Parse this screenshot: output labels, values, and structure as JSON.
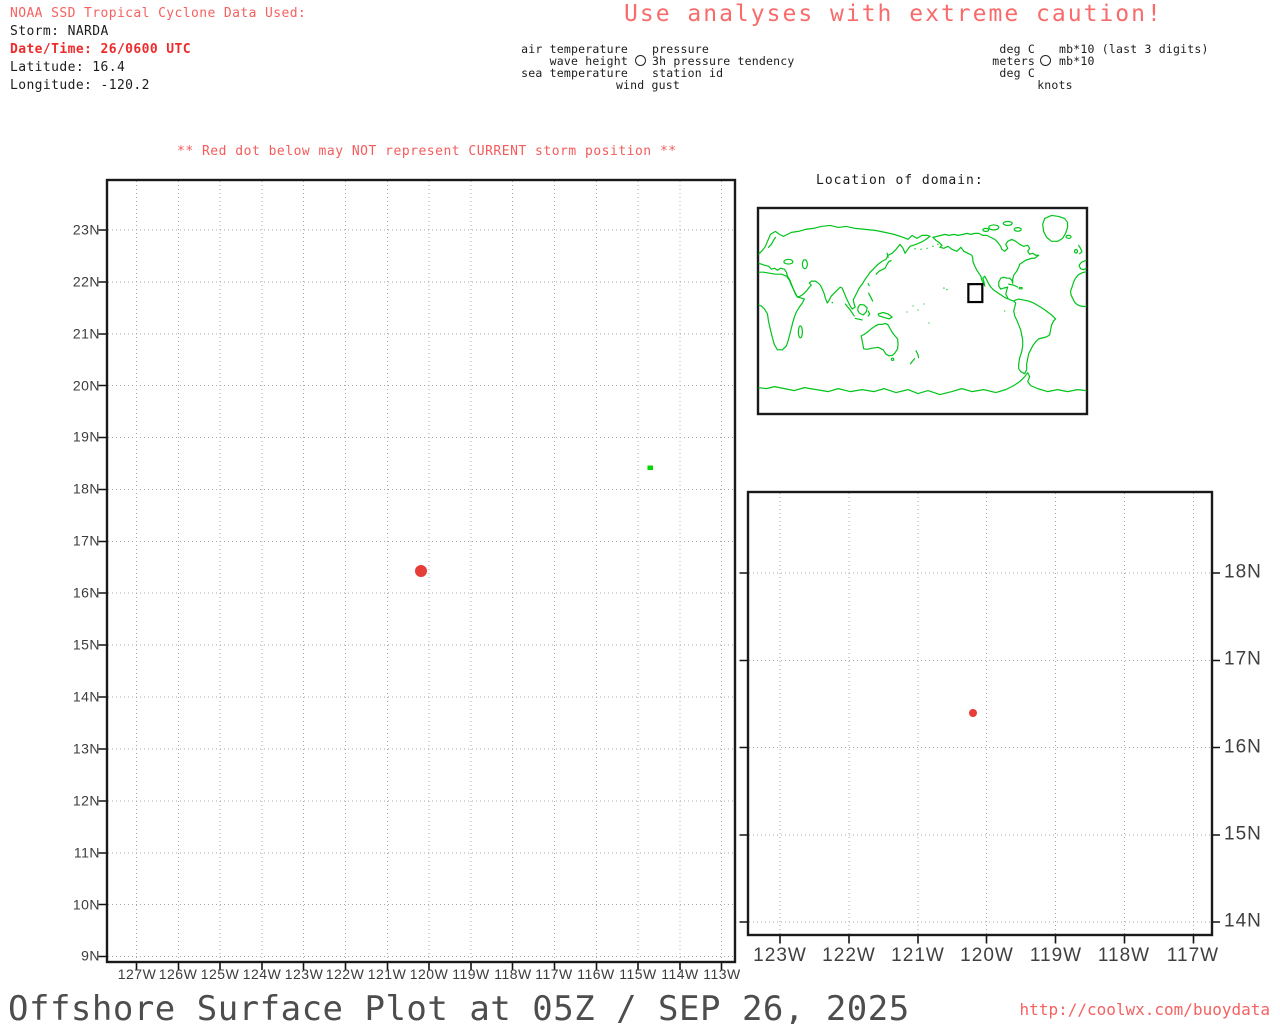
{
  "header": {
    "source_line": "NOAA SSD Tropical Cyclone Data Used:",
    "storm_line": "Storm: NARDA",
    "datetime_line": "Date/Time: 26/0600 UTC",
    "latitude_line": "Latitude: 16.4",
    "longitude_line": "Longitude: -120.2"
  },
  "caution_banner": "Use analyses with extreme caution!",
  "station_model_legend": {
    "air_temperature": "air temperature",
    "wave_height": "wave height",
    "sea_temperature": "sea temperature",
    "wind_gust": "wind gust",
    "pressure": "pressure",
    "pressure_tendency": "3h pressure tendency",
    "station_id": "station id"
  },
  "units_legend": {
    "air_temp_units": "deg C",
    "pressure_units": "mb*10 (last 3 digits)",
    "wave_units": "meters",
    "tendency_units": "mb*10",
    "sea_units": "deg C",
    "gust_units": "knots"
  },
  "warning": "** Red dot below may NOT represent CURRENT storm position **",
  "domain_map": {
    "title": "Location of domain:"
  },
  "footer": {
    "title": "Offshore Surface Plot at 05Z / SEP 26, 2025",
    "url": "http://coolwx.com/buoydata"
  },
  "colors": {
    "caution_red": "#f76060",
    "bold_red": "#ee2b2b",
    "storm_dot": "#e63d38",
    "map_green": "#00c41a",
    "grid_gray": "#ababab"
  },
  "chart_data": [
    {
      "type": "scatter",
      "name": "main_offshore_plot",
      "x_ticks": [
        "127W",
        "126W",
        "125W",
        "124W",
        "123W",
        "122W",
        "121W",
        "120W",
        "119W",
        "118W",
        "117W",
        "116W",
        "115W",
        "114W",
        "113W"
      ],
      "y_ticks": [
        "23N",
        "22N",
        "21N",
        "20N",
        "19N",
        "18N",
        "17N",
        "16N",
        "15N",
        "14N",
        "13N",
        "12N",
        "11N",
        "10N",
        "9N"
      ],
      "xlim": [
        -127.7,
        -112.7
      ],
      "ylim": [
        8.9,
        24.0
      ],
      "grid": "dotted",
      "legend_position": "none",
      "points": [
        {
          "label": "storm-position",
          "lon": -120.2,
          "lat": 16.4,
          "color": "#e63d38"
        },
        {
          "label": "green-station",
          "lon": -114.7,
          "lat": 18.4,
          "color": "#00d800"
        }
      ]
    },
    {
      "type": "scatter",
      "name": "zoomed_domain_plot",
      "x_ticks": [
        "123W",
        "122W",
        "121W",
        "120W",
        "119W",
        "118W",
        "117W"
      ],
      "y_ticks": [
        "18N",
        "17N",
        "16N",
        "15N",
        "14N"
      ],
      "xlim": [
        -123.5,
        -116.7
      ],
      "ylim": [
        13.85,
        18.95
      ],
      "grid": "dotted",
      "legend_position": "none",
      "points": [
        {
          "label": "storm-position",
          "lon": -120.2,
          "lat": 16.4,
          "color": "#e63d38"
        }
      ]
    },
    {
      "type": "scatter",
      "name": "world_locator_map",
      "domain_box": {
        "lon_range": [
          -127,
          -113
        ],
        "lat_range": [
          9,
          24
        ]
      }
    }
  ]
}
